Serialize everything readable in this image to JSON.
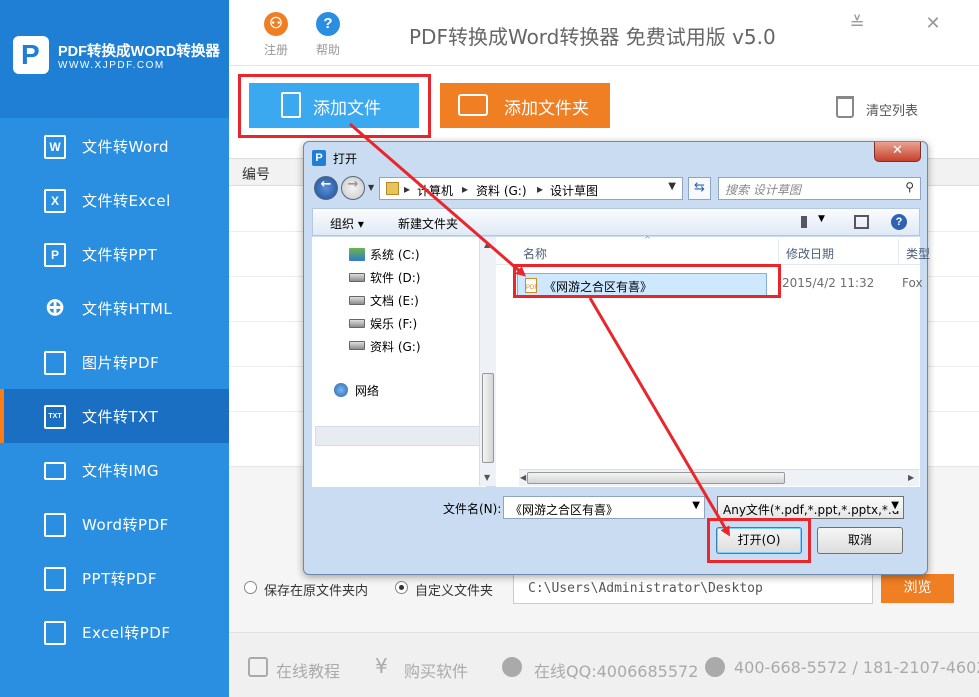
{
  "brand": {
    "title": "PDF转换成WORD转换器",
    "site": "WWW.XJPDF.COM",
    "logo_letter": "P"
  },
  "sidebar": {
    "items": [
      {
        "label": "文件转Word",
        "icon": "word-doc-icon",
        "glyph": "W",
        "active": false
      },
      {
        "label": "文件转Excel",
        "icon": "excel-doc-icon",
        "glyph": "X",
        "active": false
      },
      {
        "label": "文件转PPT",
        "icon": "ppt-doc-icon",
        "glyph": "P",
        "active": false
      },
      {
        "label": "文件转HTML",
        "icon": "globe-icon",
        "glyph": "⊕",
        "active": false
      },
      {
        "label": "图片转PDF",
        "icon": "pdf-doc-icon",
        "glyph": "",
        "active": false
      },
      {
        "label": "文件转TXT",
        "icon": "txt-doc-icon",
        "glyph": "TXT",
        "active": true
      },
      {
        "label": "文件转IMG",
        "icon": "image-icon",
        "glyph": "",
        "active": false
      },
      {
        "label": "Word转PDF",
        "icon": "pdf-doc-icon",
        "glyph": "",
        "active": false
      },
      {
        "label": "PPT转PDF",
        "icon": "pdf-doc-icon",
        "glyph": "",
        "active": false
      },
      {
        "label": "Excel转PDF",
        "icon": "pdf-doc-icon",
        "glyph": "",
        "active": false
      }
    ]
  },
  "header": {
    "register_label": "注册",
    "help_label": "帮助",
    "title": "PDF转换成Word转换器 免费试用版 v5.0",
    "minimize_glyph": "≚",
    "close_glyph": "✕",
    "colors": {
      "register": "#f07e22",
      "help": "#2a8fe0"
    }
  },
  "toolbar": {
    "add_file_label": "添加文件",
    "add_folder_label": "添加文件夹",
    "clear_list_label": "清空列表"
  },
  "table": {
    "columns": [
      "编号"
    ]
  },
  "output": {
    "option_original": "保存在原文件夹内",
    "option_custom": "自定义文件夹",
    "selected": "custom",
    "path": "C:\\Users\\Administrator\\Desktop",
    "browse_label": "浏览"
  },
  "footer": {
    "tutorial": "在线教程",
    "buy": "购买软件",
    "qq": "在线QQ:4006685572",
    "phone": "400-668-5572 / 181-2107-4602"
  },
  "dialog": {
    "title": "打开",
    "close_glyph": "✕",
    "breadcrumb": [
      "计算机",
      "资料 (G:)",
      "设计草图"
    ],
    "search_placeholder": "搜索 设计草图",
    "organize_label": "组织 ▾",
    "new_folder_label": "新建文件夹",
    "drives": [
      {
        "label": "系统 (C:)",
        "type": "system"
      },
      {
        "label": "软件 (D:)",
        "type": "disk"
      },
      {
        "label": "文档 (E:)",
        "type": "disk"
      },
      {
        "label": "娱乐 (F:)",
        "type": "disk"
      },
      {
        "label": "资料 (G:)",
        "type": "disk",
        "selected": true
      }
    ],
    "network_label": "网络",
    "columns": {
      "name": "名称",
      "date": "修改日期",
      "type": "类型"
    },
    "files": [
      {
        "name": "《网游之合区有喜》",
        "date": "2015/4/2 11:32",
        "type": "Fox"
      }
    ],
    "filename_label": "文件名(N):",
    "filename_value": "《网游之合区有喜》",
    "filetype_value": "Any文件(*.pdf,*.ppt,*.pptx,*.d",
    "open_label": "打开(O)",
    "cancel_label": "取消"
  },
  "annotation_color": "#e8262b"
}
